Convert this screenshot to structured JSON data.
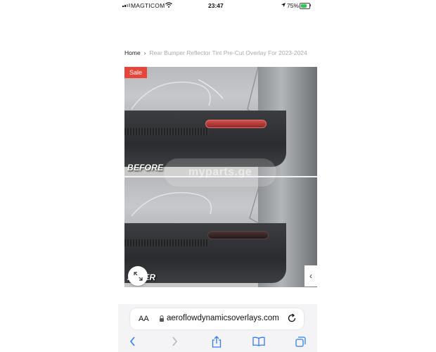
{
  "status_bar": {
    "carrier": "MAGTICOM",
    "time": "23:47",
    "battery_percent": "75%",
    "battery_level": 0.75
  },
  "breadcrumb": {
    "home": "Home",
    "separator": "›",
    "current": "Rear Bumper Reflector Tint Pre-Cut Overlay For 2023-2024"
  },
  "gallery": {
    "sale_badge": "Sale",
    "before_label": "BEFORE",
    "after_label": "AFTER",
    "watermark": "myparts.ge",
    "next_arrow": "‹"
  },
  "browser": {
    "text_size_button": "AA",
    "url": "aeroflowdynamicsoverlays.com"
  },
  "colors": {
    "sale": "#e8443a",
    "reflector_before": "#b03a38",
    "reflector_after": "#3a2a2a",
    "battery": "#2fc652",
    "accent_blue": "#2f7cf6"
  }
}
